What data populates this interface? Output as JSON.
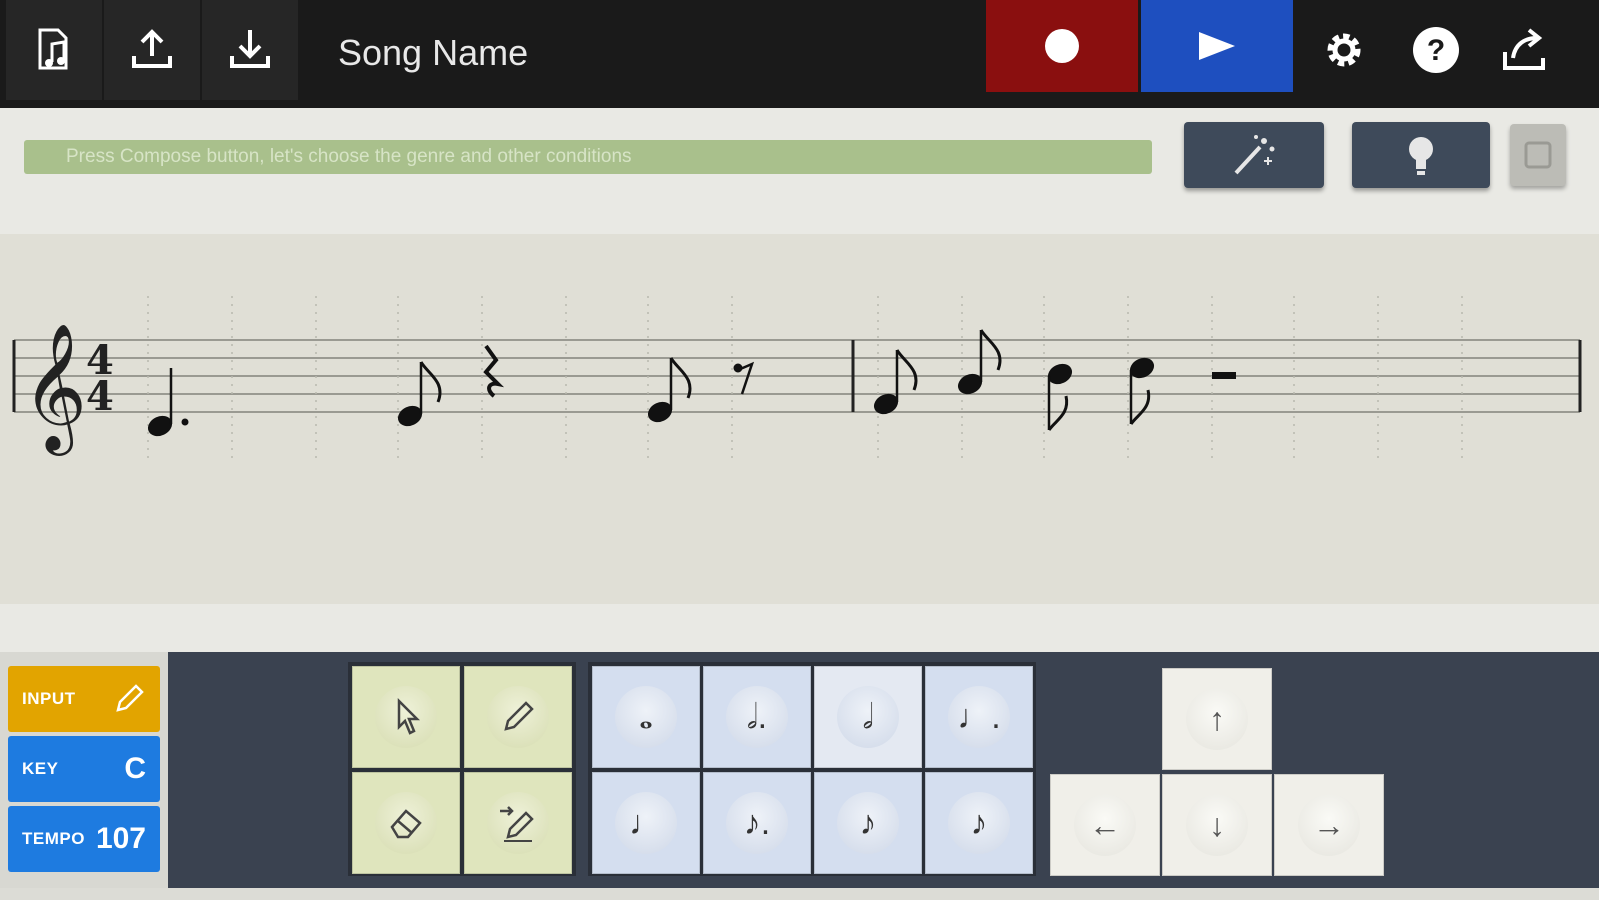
{
  "toolbar": {
    "song_name": "Song Name",
    "icons": [
      "file-music-icon",
      "upload-icon",
      "download-icon",
      "record-icon",
      "play-icon",
      "settings-icon",
      "help-icon",
      "share-icon"
    ],
    "record_color": "#8a0f0f",
    "play_color": "#1e4fbf"
  },
  "hint": {
    "text": "Press Compose button, let's choose the genre and other conditions"
  },
  "tools": {
    "icons": [
      "magic-wand-icon",
      "lightbulb-icon",
      "generic-icon"
    ]
  },
  "score": {
    "clef": "𝄞",
    "time_signature_top": "4",
    "time_signature_bottom": "4"
  },
  "left_panel": {
    "input_label": "INPUT",
    "key_label": "KEY",
    "key_value": "C",
    "tempo_label": "TEMPO",
    "tempo_value": "107",
    "input_color": "#e2a400",
    "key_color": "#1e7be0",
    "tempo_color": "#1e7be0"
  },
  "edit_tools": {
    "icons": [
      "pointer-icon",
      "pencil-icon",
      "eraser-icon",
      "insert-pencil-icon"
    ],
    "color": "#dfe5bd"
  },
  "note_values": {
    "top_row": [
      "𝅝",
      "𝅗𝅥.",
      "𝅗𝅥",
      "♩."
    ],
    "bottom_row": [
      "♩",
      "♪.",
      "♪",
      "♪"
    ],
    "color": "#d4deef"
  },
  "cursor": {
    "up": "↑",
    "left": "←",
    "down": "↓",
    "right": "→"
  }
}
